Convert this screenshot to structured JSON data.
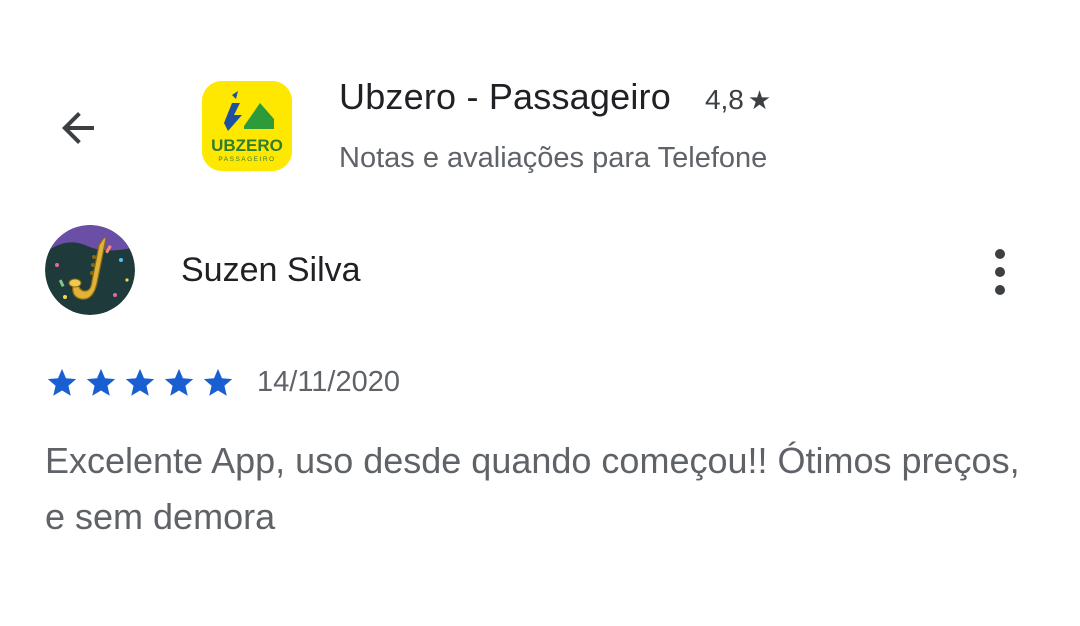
{
  "header": {
    "back_icon": "arrow-back-icon",
    "app_icon": "ubzero-app-icon",
    "app_icon_text": "UBZERO",
    "app_icon_subtext": "PASSAGEIRO",
    "app_name": "Ubzero - Passageiro",
    "rating": "4,8",
    "rating_star": "★",
    "subtitle": "Notas e avaliações para Telefone"
  },
  "review": {
    "avatar_icon": "saxophone-avatar",
    "reviewer_name": "Suzen Silva",
    "more_icon": "more-vert-icon",
    "stars": 5,
    "date": "14/11/2020",
    "text": "Excelente App, uso desde quando começou!! Ótimos preços, e sem demora"
  },
  "colors": {
    "star": "#1a5fd1",
    "app_icon_bg": "#ffe800",
    "app_icon_green": "#2e9b3a",
    "app_icon_blue": "#1e4fa0"
  }
}
